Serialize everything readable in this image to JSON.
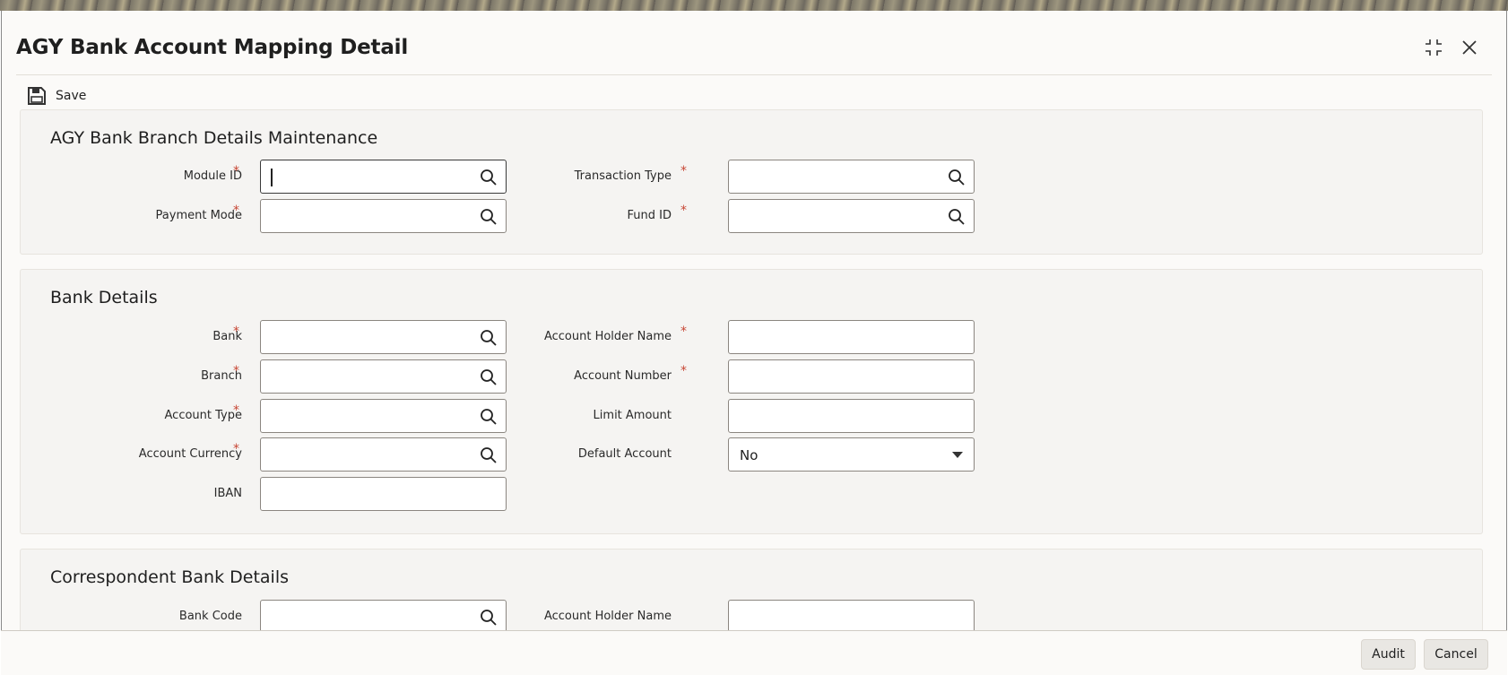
{
  "window": {
    "title": "AGY Bank Account Mapping Detail",
    "icons": [
      "collapse-icon",
      "close-icon"
    ]
  },
  "toolbar": {
    "save_label": "Save",
    "save_icon": "save-disk-icon"
  },
  "sections": {
    "branch": {
      "title": "AGY Bank Branch Details Maintenance",
      "module_id_label": "Module ID",
      "module_id_value": "",
      "transaction_type_label": "Transaction Type",
      "transaction_type_value": "",
      "payment_mode_label": "Payment Mode",
      "payment_mode_value": "",
      "fund_id_label": "Fund ID",
      "fund_id_value": ""
    },
    "bank": {
      "title": "Bank Details",
      "bank_label": "Bank",
      "branch_label": "Branch",
      "account_type_label": "Account Type",
      "account_currency_label": "Account Currency",
      "iban_label": "IBAN",
      "account_holder_name_label": "Account Holder Name",
      "account_number_label": "Account Number",
      "limit_amount_label": "Limit Amount",
      "default_account_label": "Default Account",
      "default_account_value": "No"
    },
    "correspondent": {
      "title": "Correspondent Bank Details",
      "bank_code_label": "Bank Code",
      "account_holder_name_label": "Account Holder Name"
    }
  },
  "required_marker": "*",
  "footer": {
    "audit_label": "Audit",
    "cancel_label": "Cancel"
  },
  "colors": {
    "required": "#c74634",
    "panel_bg": "#f5f4f2"
  }
}
